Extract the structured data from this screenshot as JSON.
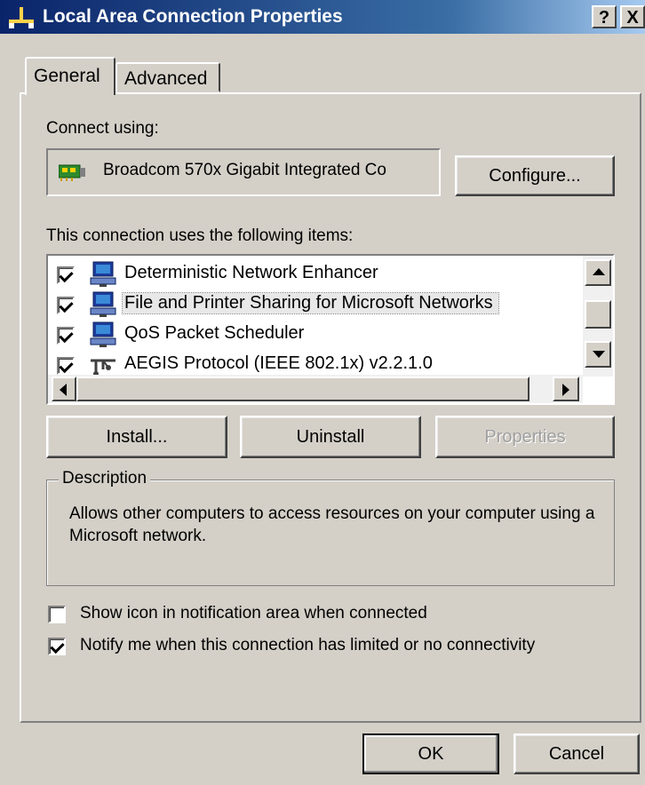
{
  "window": {
    "title": "Local Area Connection Properties",
    "help_button": "?",
    "close_button": "X"
  },
  "tabs": [
    {
      "label": "General",
      "active": true
    },
    {
      "label": "Advanced",
      "active": false
    }
  ],
  "connect_using": {
    "label": "Connect using:",
    "adapter": "Broadcom 570x Gigabit Integrated Co",
    "configure_button": "Configure..."
  },
  "items_section": {
    "label": "This connection uses the following items:",
    "items": [
      {
        "label": "Deterministic Network Enhancer",
        "checked": true,
        "icon": "network-computer-icon",
        "selected": false
      },
      {
        "label": "File and Printer Sharing for Microsoft Networks",
        "checked": true,
        "icon": "network-computer-icon",
        "selected": true
      },
      {
        "label": "QoS Packet Scheduler",
        "checked": true,
        "icon": "network-computer-icon",
        "selected": false
      },
      {
        "label": "AEGIS Protocol (IEEE 802.1x) v2.2.1.0",
        "checked": true,
        "icon": "protocol-icon",
        "selected": false
      }
    ]
  },
  "item_buttons": {
    "install": "Install...",
    "uninstall": "Uninstall",
    "properties": "Properties"
  },
  "description": {
    "title": "Description",
    "text": "Allows other computers to access resources on your computer using a Microsoft network."
  },
  "options": {
    "show_icon": {
      "label": "Show icon in notification area when connected",
      "checked": false
    },
    "notify": {
      "label": "Notify me when this connection has limited or no connectivity",
      "checked": true
    }
  },
  "footer": {
    "ok": "OK",
    "cancel": "Cancel"
  },
  "colors": {
    "titlebar_start": "#0a246a",
    "titlebar_end": "#a6caf0",
    "dialog_bg": "#d4d0c8"
  }
}
